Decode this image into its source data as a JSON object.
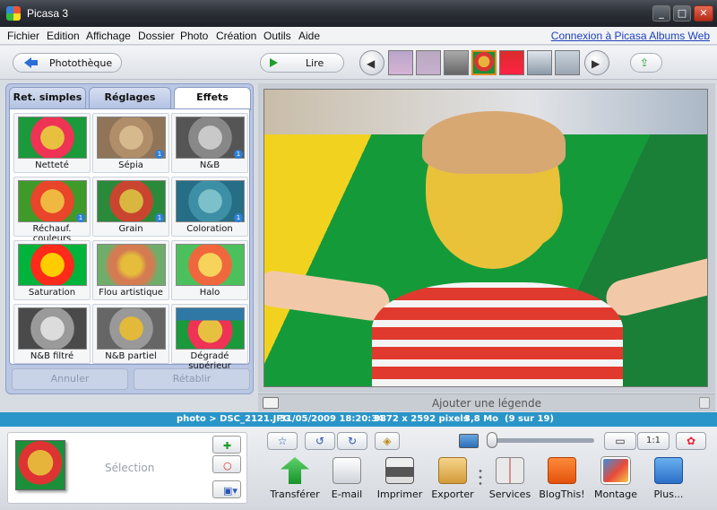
{
  "window": {
    "title": "Picasa 3"
  },
  "menu": {
    "items": [
      "Fichier",
      "Edition",
      "Affichage",
      "Dossier",
      "Photo",
      "Création",
      "Outils",
      "Aide"
    ],
    "web_link": "Connexion à Picasa Albums Web"
  },
  "toolbar": {
    "library_label": "Photothèque",
    "play_label": "Lire"
  },
  "tabs": [
    {
      "label": "Ret. simples",
      "active": false
    },
    {
      "label": "Réglages",
      "active": false
    },
    {
      "label": "Effets",
      "active": true
    }
  ],
  "effects": [
    {
      "name": "Netteté",
      "badge": ""
    },
    {
      "name": "Sépia",
      "badge": "1"
    },
    {
      "name": "N&B",
      "badge": "1"
    },
    {
      "name": "Réchauf. couleurs",
      "badge": "1"
    },
    {
      "name": "Grain",
      "badge": "1"
    },
    {
      "name": "Coloration",
      "badge": "1"
    },
    {
      "name": "Saturation",
      "badge": ""
    },
    {
      "name": "Flou artistique",
      "badge": ""
    },
    {
      "name": "Halo",
      "badge": ""
    },
    {
      "name": "N&B filtré",
      "badge": ""
    },
    {
      "name": "N&B partiel",
      "badge": ""
    },
    {
      "name": "Dégradé supérieur",
      "badge": ""
    }
  ],
  "edit_buttons": {
    "undo": "Annuler",
    "redo": "Rétablir"
  },
  "caption": {
    "placeholder": "Ajouter une légende"
  },
  "info": {
    "path": "photo > DSC_2121.JPG",
    "datetime": "31/05/2009 18:20:34",
    "dimensions": "3872 x 2592 pixels",
    "size": "3,8 Mo",
    "position": "(9 sur 19)"
  },
  "tray": {
    "selection_label": "Sélection"
  },
  "zoom": {
    "one_to_one": "1:1"
  },
  "actions": [
    {
      "label": "Transférer",
      "icon": "upload-icon"
    },
    {
      "label": "E-mail",
      "icon": "email-icon"
    },
    {
      "label": "Imprimer",
      "icon": "printer-icon"
    },
    {
      "label": "Exporter",
      "icon": "folder-icon"
    },
    {
      "label": "Services",
      "icon": "book-icon"
    },
    {
      "label": "BlogThis!",
      "icon": "blogger-icon"
    },
    {
      "label": "Montage",
      "icon": "collage-icon"
    },
    {
      "label": "Plus...",
      "icon": "more-icon"
    }
  ],
  "colors": {
    "accent": "#2a95c8",
    "selected_thumb_border": "#e08a1c"
  }
}
